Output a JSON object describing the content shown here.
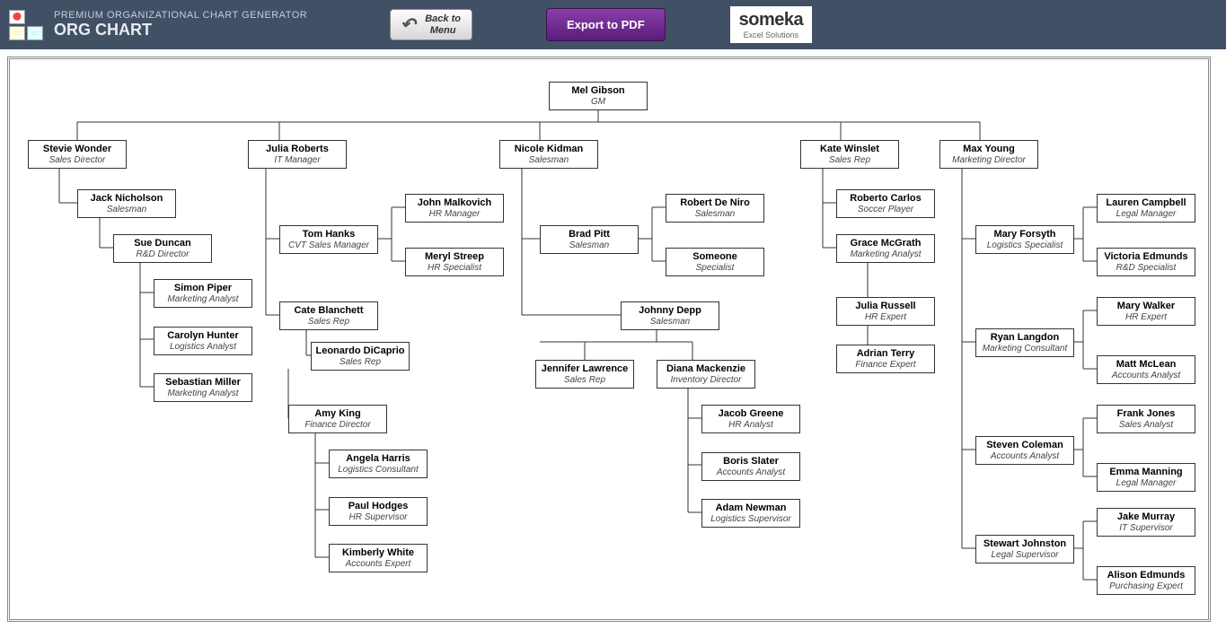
{
  "header": {
    "subtitle": "PREMIUM ORGANIZATIONAL CHART GENERATOR",
    "title": "ORG CHART",
    "back_label_line1": "Back to",
    "back_label_line2": "Menu",
    "export_label": "Export to PDF",
    "logo_text": "someka",
    "logo_sub": "Excel Solutions"
  },
  "nodes": {
    "root": {
      "name": "Mel Gibson",
      "role": "GM"
    },
    "stevie": {
      "name": "Stevie Wonder",
      "role": "Sales Director"
    },
    "julia": {
      "name": "Julia Roberts",
      "role": "IT Manager"
    },
    "nicole": {
      "name": "Nicole Kidman",
      "role": "Salesman"
    },
    "kate": {
      "name": "Kate Winslet",
      "role": "Sales Rep"
    },
    "max": {
      "name": "Max Young",
      "role": "Marketing Director"
    },
    "jack": {
      "name": "Jack Nicholson",
      "role": "Salesman"
    },
    "sue": {
      "name": "Sue Duncan",
      "role": "R&D Director"
    },
    "simon": {
      "name": "Simon Piper",
      "role": "Marketing Analyst"
    },
    "carolyn": {
      "name": "Carolyn Hunter",
      "role": "Logistics Analyst"
    },
    "sebastian": {
      "name": "Sebastian Miller",
      "role": "Marketing Analyst"
    },
    "tom": {
      "name": "Tom Hanks",
      "role": "CVT Sales Manager"
    },
    "john": {
      "name": "John Malkovich",
      "role": "HR Manager"
    },
    "meryl": {
      "name": "Meryl Streep",
      "role": "HR Specialist"
    },
    "cate": {
      "name": "Cate Blanchett",
      "role": "Sales Rep"
    },
    "leo": {
      "name": "Leonardo DiCaprio",
      "role": "Sales Rep"
    },
    "amy": {
      "name": "Amy King",
      "role": "Finance Director"
    },
    "angela": {
      "name": "Angela Harris",
      "role": "Logistics Consultant"
    },
    "paul": {
      "name": "Paul Hodges",
      "role": "HR Supervisor"
    },
    "kimberly": {
      "name": "Kimberly White",
      "role": "Accounts Expert"
    },
    "brad": {
      "name": "Brad Pitt",
      "role": "Salesman"
    },
    "robert": {
      "name": "Robert De Niro",
      "role": "Salesman"
    },
    "someone": {
      "name": "Someone",
      "role": "Specialist"
    },
    "johnny": {
      "name": "Johnny Depp",
      "role": "Salesman"
    },
    "jennifer": {
      "name": "Jennifer Lawrence",
      "role": "Sales Rep"
    },
    "diana": {
      "name": "Diana Mackenzie",
      "role": "Inventory Director"
    },
    "jacob": {
      "name": "Jacob Greene",
      "role": "HR Analyst"
    },
    "boris": {
      "name": "Boris Slater",
      "role": "Accounts Analyst"
    },
    "adam": {
      "name": "Adam Newman",
      "role": "Logistics Supervisor"
    },
    "roberto": {
      "name": "Roberto Carlos",
      "role": "Soccer Player"
    },
    "grace": {
      "name": "Grace McGrath",
      "role": "Marketing Analyst"
    },
    "juliar": {
      "name": "Julia Russell",
      "role": "HR Expert"
    },
    "adrian": {
      "name": "Adrian Terry",
      "role": "Finance Expert"
    },
    "maryf": {
      "name": "Mary Forsyth",
      "role": "Logistics Specialist"
    },
    "ryan": {
      "name": "Ryan Langdon",
      "role": "Marketing Consultant"
    },
    "steven": {
      "name": "Steven Coleman",
      "role": "Accounts Analyst"
    },
    "stewart": {
      "name": "Stewart Johnston",
      "role": "Legal Supervisor"
    },
    "lauren": {
      "name": "Lauren Campbell",
      "role": "Legal Manager"
    },
    "victoria": {
      "name": "Victoria Edmunds",
      "role": "R&D Specialist"
    },
    "maryw": {
      "name": "Mary Walker",
      "role": "HR Expert"
    },
    "matt": {
      "name": "Matt McLean",
      "role": "Accounts Analyst"
    },
    "frank": {
      "name": "Frank Jones",
      "role": "Sales Analyst"
    },
    "emma": {
      "name": "Emma Manning",
      "role": "Legal Manager"
    },
    "jake": {
      "name": "Jake Murray",
      "role": "IT Supervisor"
    },
    "alison": {
      "name": "Alison Edmunds",
      "role": "Purchasing Expert"
    }
  }
}
